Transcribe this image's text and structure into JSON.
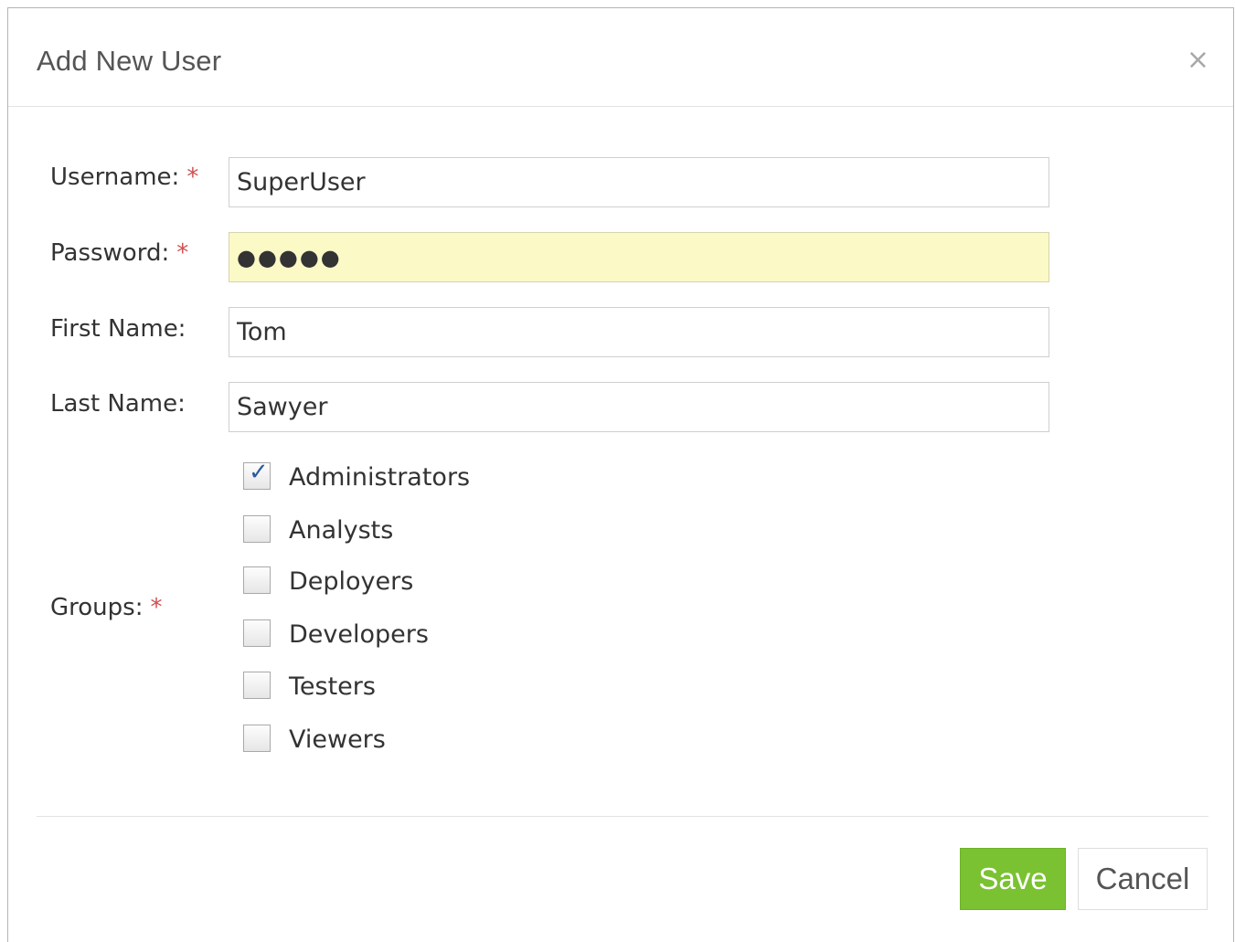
{
  "dialog": {
    "title": "Add New User",
    "close_glyph": "×",
    "close_icon": "close-icon"
  },
  "form": {
    "required_marker": "*",
    "username": {
      "label": "Username:",
      "value": "SuperUser",
      "required": true
    },
    "password": {
      "label": "Password:",
      "value": "●●●●●",
      "required": true,
      "highlight_color": "#fbf9c6"
    },
    "first_name": {
      "label": "First Name:",
      "value": "Tom",
      "required": false
    },
    "last_name": {
      "label": "Last Name:",
      "value": "Sawyer",
      "required": false
    },
    "groups": {
      "label": "Groups:",
      "required": true,
      "check_glyph": "✓",
      "options": [
        {
          "label": "Administrators",
          "checked": true
        },
        {
          "label": "Analysts",
          "checked": false
        },
        {
          "label": "Deployers",
          "checked": false
        },
        {
          "label": "Developers",
          "checked": false
        },
        {
          "label": "Testers",
          "checked": false
        },
        {
          "label": "Viewers",
          "checked": false
        }
      ]
    }
  },
  "footer": {
    "save_label": "Save",
    "cancel_label": "Cancel",
    "save_color": "#7ac231"
  }
}
